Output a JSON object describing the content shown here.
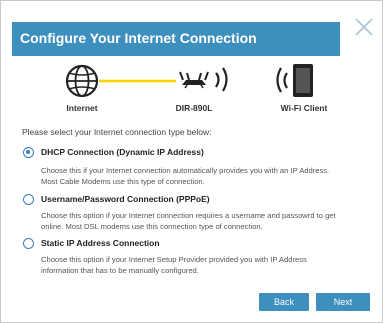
{
  "dialog": {
    "title": "Configure Your Internet Connection",
    "accent_color": "#3d8fbd"
  },
  "diagram": {
    "nodes": [
      {
        "label": "Internet",
        "icon": "globe-icon"
      },
      {
        "label": "DIR-890L",
        "icon": "router-icon"
      },
      {
        "label": "Wi-Fi Client",
        "icon": "wifi-device-icon"
      }
    ],
    "link_color": "#f5d200"
  },
  "prompt": "Please select your Internet connection type below:",
  "options": [
    {
      "title": "DHCP Connection (Dynamic IP Address)",
      "line1": "Choose this if your Internet connection automatically provides you with an IP Address.",
      "line2": "Most Cable Modems use this type of connection.",
      "selected": true
    },
    {
      "title": "Username/Password Connection (PPPoE)",
      "line1": "Choose this option if your Internet connection requires a username and passowrd to get",
      "line2": "online. Most DSL modems use this connection type of connection.",
      "selected": false
    },
    {
      "title": "Static IP Address Connection",
      "line1": "Choose this option if your Internet Setup Provider provided you with IP Address",
      "line2": "information that has to be manually configured.",
      "selected": false
    }
  ],
  "buttons": {
    "back": "Back",
    "next": "Next"
  }
}
